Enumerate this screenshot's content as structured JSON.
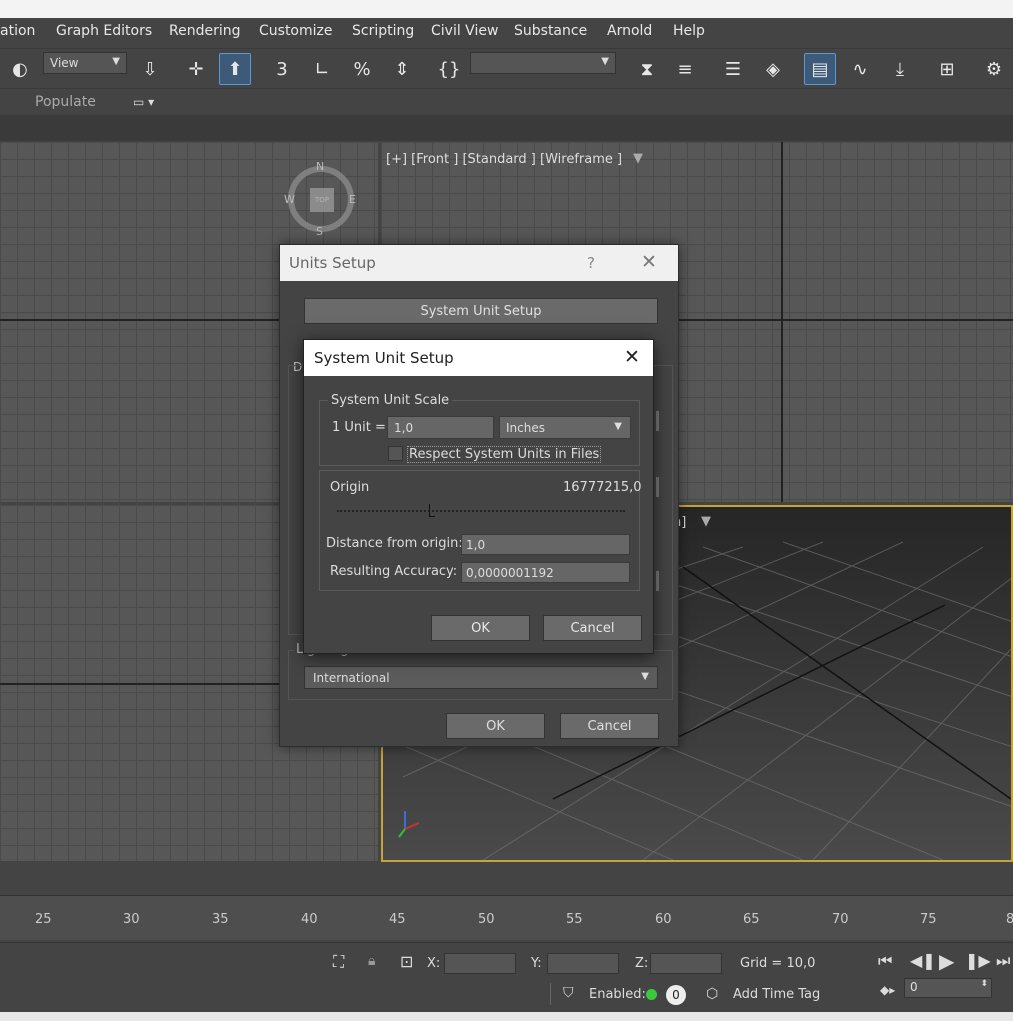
{
  "menu": [
    "ation",
    "Graph Editors",
    "Rendering",
    "Customize",
    "Scripting",
    "Civil View",
    "Substance",
    "Arnold",
    "Help"
  ],
  "toolbar": {
    "view_select": "View"
  },
  "ribbon": {
    "populate": "Populate"
  },
  "viewports": {
    "front_label": "[+] [Front ] [Standard ] [Wireframe ]",
    "persp_label_tail": "n]",
    "viewcube": {
      "n": "N",
      "s": "S",
      "e": "E",
      "w": "W",
      "face": "TOP"
    }
  },
  "timeline": {
    "ticks": [
      "25",
      "30",
      "35",
      "40",
      "45",
      "50",
      "55",
      "60",
      "65",
      "70",
      "75",
      "8"
    ]
  },
  "status": {
    "x_label": "X:",
    "y_label": "Y:",
    "z_label": "Z:",
    "grid": "Grid = 10,0",
    "enabled": "Enabled:",
    "enabled_count": "0",
    "add_time_tag": "Add Time Tag",
    "frame_value": "0"
  },
  "units_setup": {
    "title": "Units Setup",
    "help": "?",
    "system_unit_setup_button": "System Unit Setup",
    "display_label_partial": "Di",
    "lighting_units_label": "Lighting Units",
    "lighting_units_value": "International",
    "ok": "OK",
    "cancel": "Cancel"
  },
  "system_unit_setup": {
    "title": "System Unit Setup",
    "scale_group": "System Unit Scale",
    "unit_label": "1 Unit =",
    "unit_value": "1,0",
    "unit_type": "Inches",
    "respect_label": "Respect System Units in Files",
    "respect_checked": false,
    "origin_label": "Origin",
    "origin_value": "16777215,0",
    "origin_slider_position": 0.32,
    "distance_label": "Distance from origin:",
    "distance_value": "1,0",
    "accuracy_label": "Resulting Accuracy:",
    "accuracy_value": "0,0000001192",
    "ok": "OK",
    "cancel": "Cancel"
  },
  "colors": {
    "accent": "#5a9bd5",
    "active_viewport_border": "#c8a23a",
    "enabled_dot": "#3cc83c"
  }
}
